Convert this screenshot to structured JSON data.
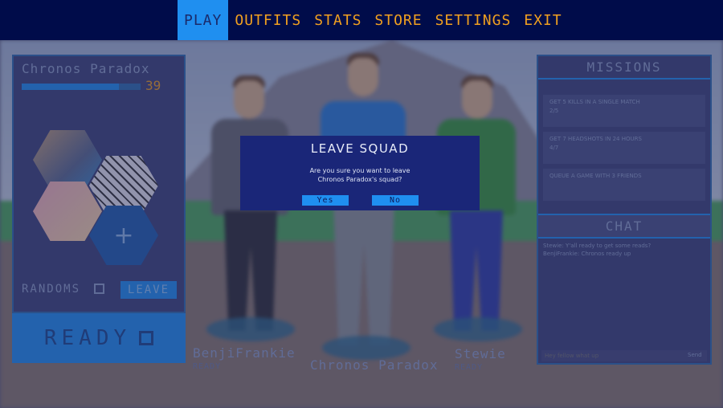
{
  "nav": {
    "items": [
      {
        "label": "PLAY",
        "active": true
      },
      {
        "label": "OUTFITS",
        "active": false
      },
      {
        "label": "STATS",
        "active": false
      },
      {
        "label": "STORE",
        "active": false
      },
      {
        "label": "SETTINGS",
        "active": false
      },
      {
        "label": "EXIT",
        "active": false
      }
    ]
  },
  "player": {
    "name": "Chronos Paradox",
    "level": "39",
    "level_progress": 0.82
  },
  "squad_panel": {
    "add_icon": "+",
    "randoms_label": "RANDOMS",
    "leave_label": "LEAVE",
    "ready_label": "READY"
  },
  "characters": [
    {
      "name": "BenjiFrankie",
      "status": "READY"
    },
    {
      "name": "Chronos Paradox",
      "status": ""
    },
    {
      "name": "Stewie",
      "status": "READY"
    }
  ],
  "missions": {
    "title": "MISSIONS",
    "items": [
      {
        "text": "GET 5 KILLS IN A SINGLE MATCH",
        "progress": "2/5"
      },
      {
        "text": "GET 7 HEADSHOTS IN 24 HOURS",
        "progress": "4/7"
      },
      {
        "text": "QUEUE A GAME WITH 3 FRIENDS",
        "progress": ""
      }
    ]
  },
  "chat": {
    "title": "CHAT",
    "messages": [
      "Stewie: Y'all ready to get some reads?",
      "BenjiFrankie: Chronos ready up"
    ],
    "input_placeholder": "Hey fellow what up",
    "send_label": "Send"
  },
  "dialog": {
    "title": "LEAVE SQUAD",
    "message_line1": "Are you sure you want to leave",
    "message_line2": "Chronos Paradox's squad?",
    "yes_label": "Yes",
    "no_label": "No"
  },
  "colors": {
    "nav_bg": "#000c4a",
    "nav_text": "#f0a020",
    "accent": "#1f8ff0",
    "dialog_bg": "#1a2678"
  }
}
